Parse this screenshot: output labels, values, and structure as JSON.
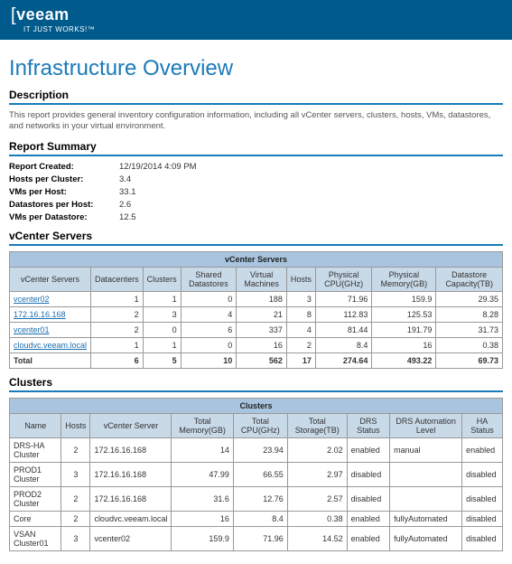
{
  "brand": {
    "name": "veeam",
    "tagline": "IT JUST WORKS!™"
  },
  "page": {
    "title": "Infrastructure Overview",
    "desc_heading": "Description",
    "description": "This report provides general inventory configuration information, including all vCenter servers, clusters, hosts, VMs, datastores, and networks in your virtual environment."
  },
  "summary": {
    "heading": "Report Summary",
    "rows": [
      {
        "label": "Report Created:",
        "value": "12/19/2014 4:09 PM"
      },
      {
        "label": "Hosts per Cluster:",
        "value": "3.4"
      },
      {
        "label": "VMs per Host:",
        "value": "33.1"
      },
      {
        "label": "Datastores per Host:",
        "value": "2.6"
      },
      {
        "label": "VMs per Datastore:",
        "value": "12.5"
      }
    ]
  },
  "vcenter": {
    "heading": "vCenter Servers",
    "caption": "vCenter Servers",
    "columns": [
      "vCenter Servers",
      "Datacenters",
      "Clusters",
      "Shared Datastores",
      "Virtual Machines",
      "Hosts",
      "Physical CPU(GHz)",
      "Physical Memory(GB)",
      "Datastore Capacity(TB)"
    ],
    "rows": [
      {
        "name": "vcenter02",
        "dc": "1",
        "cl": "1",
        "ds": "0",
        "vm": "188",
        "hosts": "3",
        "cpu": "71.96",
        "mem": "159.9",
        "cap": "29.35"
      },
      {
        "name": "172.16.16.168",
        "dc": "2",
        "cl": "3",
        "ds": "4",
        "vm": "21",
        "hosts": "8",
        "cpu": "112.83",
        "mem": "125.53",
        "cap": "8.28"
      },
      {
        "name": "vcenter01",
        "dc": "2",
        "cl": "0",
        "ds": "6",
        "vm": "337",
        "hosts": "4",
        "cpu": "81.44",
        "mem": "191.79",
        "cap": "31.73"
      },
      {
        "name": "cloudvc.veeam.local",
        "dc": "1",
        "cl": "1",
        "ds": "0",
        "vm": "16",
        "hosts": "2",
        "cpu": "8.4",
        "mem": "16",
        "cap": "0.38"
      }
    ],
    "total": {
      "label": "Total",
      "dc": "6",
      "cl": "5",
      "ds": "10",
      "vm": "562",
      "hosts": "17",
      "cpu": "274.64",
      "mem": "493.22",
      "cap": "69.73"
    }
  },
  "clusters": {
    "heading": "Clusters",
    "caption": "Clusters",
    "columns": [
      "Name",
      "Hosts",
      "vCenter Server",
      "Total Memory(GB)",
      "Total CPU(GHz)",
      "Total Storage(TB)",
      "DRS Status",
      "DRS Automation Level",
      "HA Status"
    ],
    "rows": [
      {
        "name": "DRS-HA Cluster",
        "hosts": "2",
        "vc": "172.16.16.168",
        "mem": "14",
        "cpu": "23.94",
        "stor": "2.02",
        "drs": "enabled",
        "lvl": "manual",
        "ha": "enabled"
      },
      {
        "name": "PROD1 Cluster",
        "hosts": "3",
        "vc": "172.16.16.168",
        "mem": "47.99",
        "cpu": "66.55",
        "stor": "2.97",
        "drs": "disabled",
        "lvl": "",
        "ha": "disabled"
      },
      {
        "name": "PROD2 Cluster",
        "hosts": "2",
        "vc": "172.16.16.168",
        "mem": "31.6",
        "cpu": "12.76",
        "stor": "2.57",
        "drs": "disabled",
        "lvl": "",
        "ha": "disabled"
      },
      {
        "name": "Core",
        "hosts": "2",
        "vc": "cloudvc.veeam.local",
        "mem": "16",
        "cpu": "8.4",
        "stor": "0.38",
        "drs": "enabled",
        "lvl": "fullyAutomated",
        "ha": "disabled"
      },
      {
        "name": "VSAN Cluster01",
        "hosts": "3",
        "vc": "vcenter02",
        "mem": "159.9",
        "cpu": "71.96",
        "stor": "14.52",
        "drs": "enabled",
        "lvl": "fullyAutomated",
        "ha": "disabled"
      }
    ]
  }
}
